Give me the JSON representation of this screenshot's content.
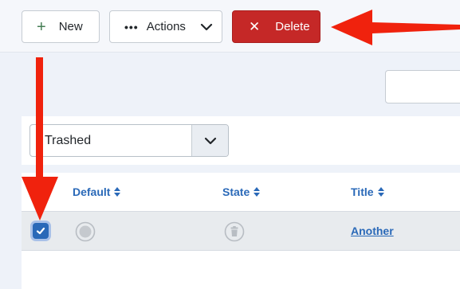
{
  "toolbar": {
    "new_label": "New",
    "actions_label": "Actions",
    "delete_label": "Delete"
  },
  "filter": {
    "selected": "Trashed"
  },
  "table": {
    "headers": [
      "Default",
      "State",
      "Title"
    ],
    "rows": [
      {
        "checked": true,
        "title": "Another"
      }
    ]
  },
  "colors": {
    "delete_red": "#c52827",
    "link_blue": "#2a69b8",
    "annotation_arrow": "#f0220d"
  }
}
